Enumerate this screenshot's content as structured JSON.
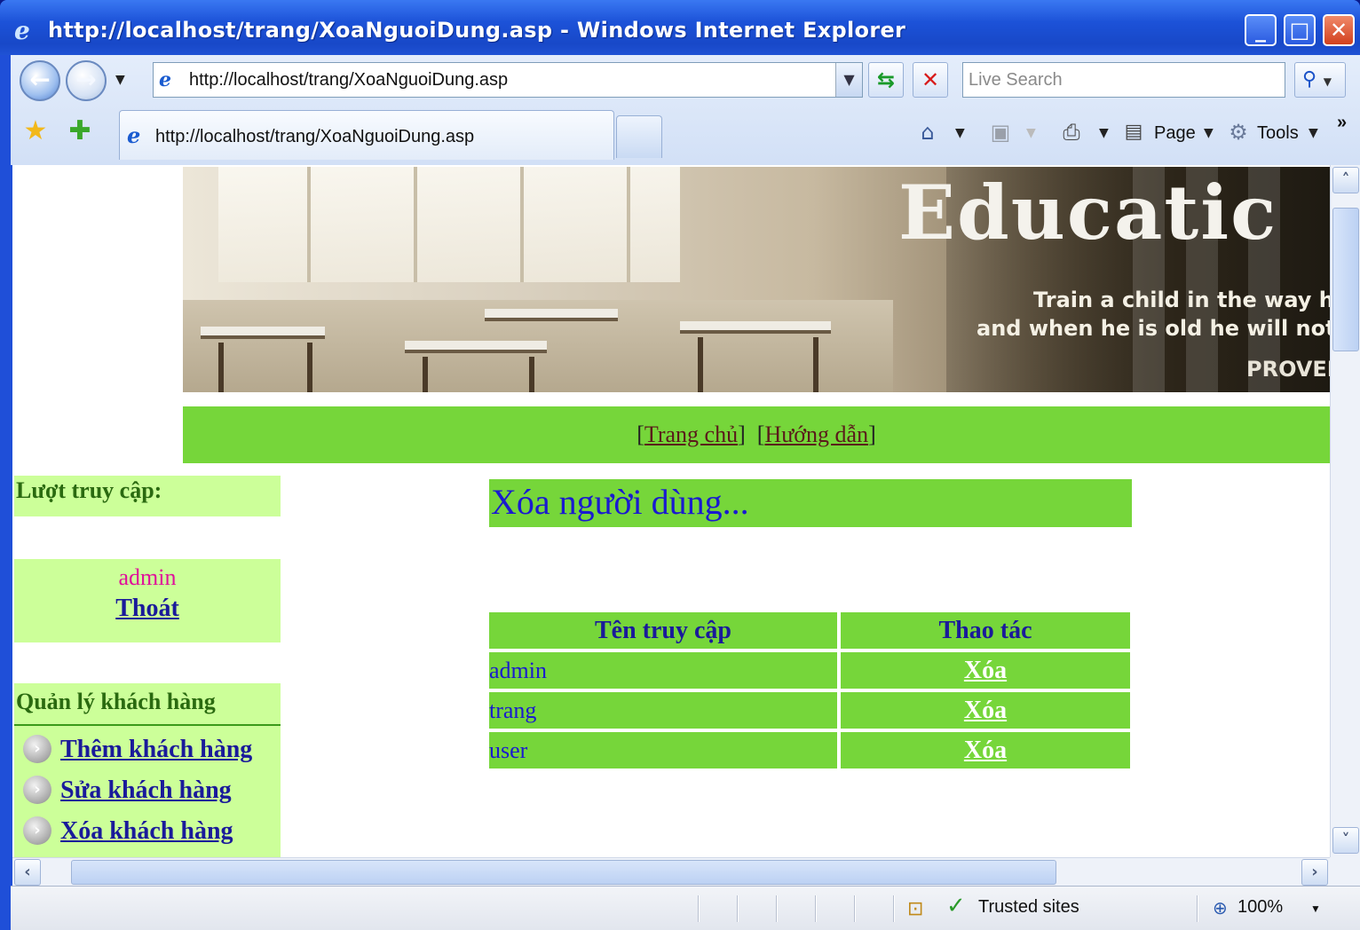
{
  "window": {
    "title": "http://localhost/trang/XoaNguoiDung.asp - Windows Internet Explorer",
    "minimize": "_",
    "maximize": "□",
    "close": "✕"
  },
  "toolbar": {
    "address": "http://localhost/trang/XoaNguoiDung.asp",
    "search_placeholder": "Live Search",
    "tab_title": "http://localhost/trang/XoaNguoiDung.asp",
    "page_label": "Page",
    "tools_label": "Tools",
    "chevron": "»"
  },
  "banner": {
    "title": "Educatic",
    "quote_line1": "Train a child in the way he sh",
    "quote_line2": "and when he is old he will not turn",
    "proverb": "PROVER"
  },
  "nav": {
    "home": "Trang chủ",
    "guide": "Hướng dẫn"
  },
  "sidebar": {
    "visits_heading": "Lượt truy cập:",
    "username": "admin",
    "logout": "Thoát",
    "customers_heading": "Quản lý khách hàng",
    "links": [
      {
        "label": "Thêm khách hàng"
      },
      {
        "label": "Sửa khách hàng"
      },
      {
        "label": "Xóa khách hàng"
      }
    ]
  },
  "main": {
    "title": "Xóa người dùng...",
    "table": {
      "headers": [
        "Tên truy cập",
        "Thao tác"
      ],
      "rows": [
        {
          "username": "admin",
          "action": "Xóa"
        },
        {
          "username": "trang",
          "action": "Xóa"
        },
        {
          "username": "user",
          "action": "Xóa"
        }
      ]
    }
  },
  "statusbar": {
    "zone": "Trusted sites",
    "zoom": "100%"
  }
}
